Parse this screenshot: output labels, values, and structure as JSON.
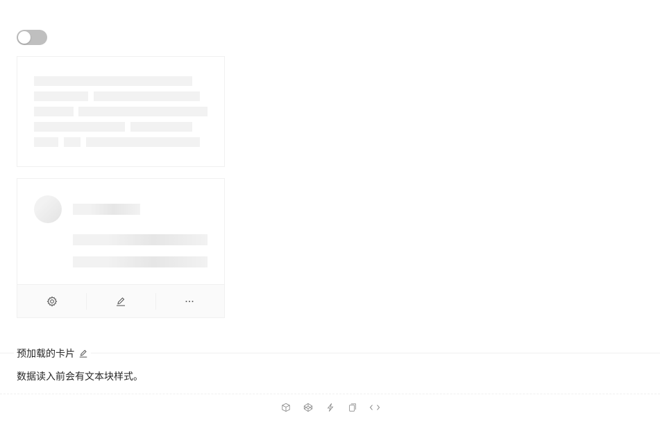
{
  "demo": {
    "toggle_state": "off",
    "card_actions": [
      {
        "icon": "setting-icon"
      },
      {
        "icon": "edit-icon"
      },
      {
        "icon": "ellipsis-icon"
      }
    ]
  },
  "meta": {
    "title": "预加载的卡片",
    "description": "数据读入前会有文本块样式。"
  },
  "code_actions": [
    {
      "icon": "codesandbox-icon"
    },
    {
      "icon": "codepen-icon"
    },
    {
      "icon": "thunderbolt-icon"
    },
    {
      "icon": "copy-icon"
    },
    {
      "icon": "code-icon"
    }
  ],
  "colors": {
    "toggle_off": "#bfbfbf",
    "skeleton": "#f2f2f2",
    "border": "#f0f0f0",
    "icon": "#8c8c8c"
  }
}
